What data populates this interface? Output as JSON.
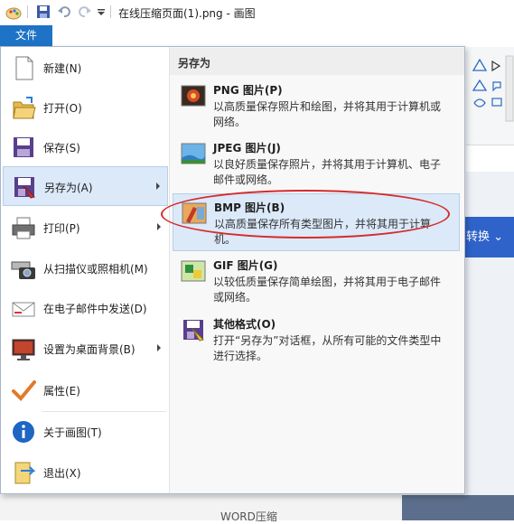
{
  "titlebar": {
    "title": "在线压缩页面(1).png - 画图"
  },
  "file_tab": {
    "label": "文件"
  },
  "menu": {
    "items": [
      {
        "label": "新建(N)",
        "icon": "new-file-icon"
      },
      {
        "label": "打开(O)",
        "icon": "open-folder-icon"
      },
      {
        "label": "保存(S)",
        "icon": "save-floppy-icon"
      },
      {
        "label": "另存为(A)",
        "icon": "save-as-icon",
        "active": true
      },
      {
        "label": "打印(P)",
        "icon": "printer-icon"
      },
      {
        "label": "从扫描仪或照相机(M)",
        "icon": "scanner-camera-icon"
      },
      {
        "label": "在电子邮件中发送(D)",
        "icon": "email-icon"
      },
      {
        "label": "设置为桌面背景(B)",
        "icon": "desktop-background-icon"
      },
      {
        "label": "属性(E)",
        "icon": "checkmark-icon"
      },
      {
        "label": "关于画图(T)",
        "icon": "info-icon"
      },
      {
        "label": "退出(X)",
        "icon": "exit-icon"
      }
    ]
  },
  "save_as_panel": {
    "heading": "另存为",
    "formats": [
      {
        "name": "PNG 图片(P)",
        "desc": "以高质量保存照片和绘图，并将其用于计算机或网络。",
        "icon": "png-image-icon"
      },
      {
        "name": "JPEG 图片(J)",
        "desc": "以良好质量保存照片，并将其用于计算机、电子邮件或网络。",
        "icon": "jpeg-image-icon"
      },
      {
        "name": "BMP 图片(B)",
        "desc": "以高质量保存所有类型图片，并将其用于计算机。",
        "icon": "bmp-image-icon",
        "active": true
      },
      {
        "name": "GIF 图片(G)",
        "desc": "以较低质量保存简单绘图，并将其用于电子邮件或网络。",
        "icon": "gif-image-icon"
      },
      {
        "name": "其他格式(O)",
        "desc": "打开“另存为”对话框，从所有可能的文件类型中进行选择。",
        "icon": "other-formats-icon"
      }
    ]
  },
  "background": {
    "convert_button": "转换",
    "bottom_text": "WORD压缩"
  },
  "colors": {
    "accent": "#1e73c6",
    "highlight": "#dbe9f9",
    "annotation": "#d62b2b"
  }
}
